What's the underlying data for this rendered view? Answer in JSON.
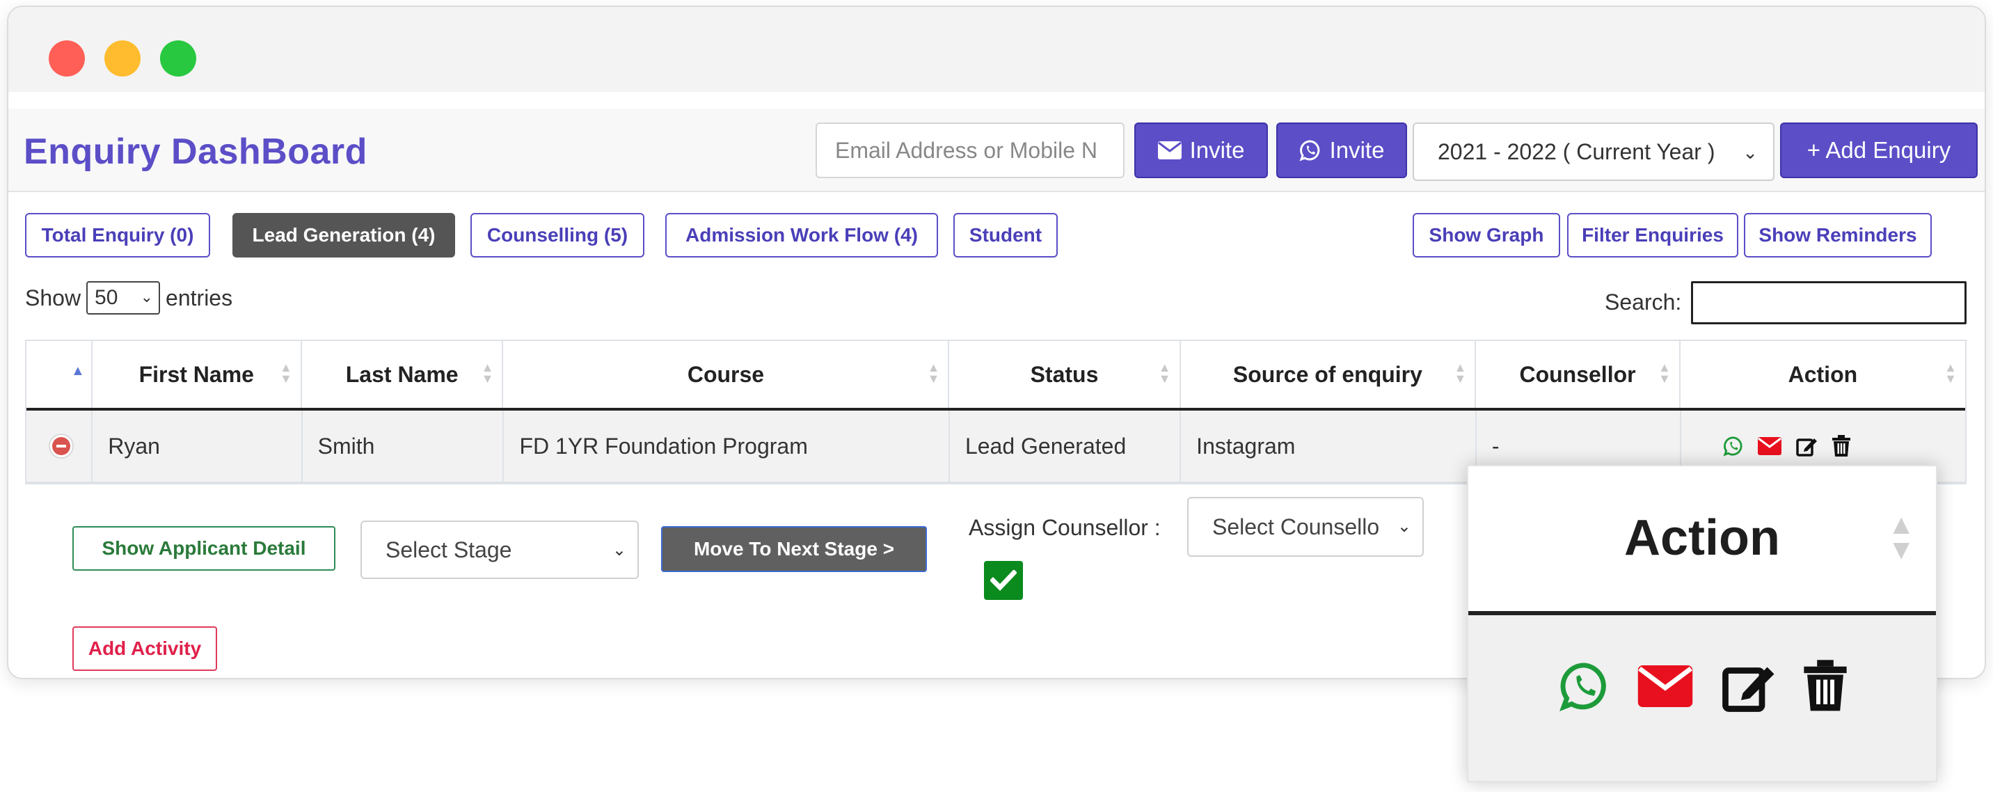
{
  "header": {
    "title": "Enquiry DashBoard",
    "invite_placeholder": "Email Address or Mobile N",
    "email_invite_label": "Invite",
    "whatsapp_invite_label": "Invite",
    "year_selected": "2021 - 2022 ( Current Year )",
    "add_enquiry_label": "+ Add Enquiry"
  },
  "tabs": {
    "total": "Total Enquiry (0)",
    "lead": "Lead Generation (4)",
    "counselling": "Counselling (5)",
    "admission": "Admission Work Flow (4)",
    "student": "Student",
    "show_graph": "Show Graph",
    "filter": "Filter Enquiries",
    "reminders": "Show Reminders"
  },
  "table_controls": {
    "show": "Show",
    "entries_value": "50",
    "entries": "entries",
    "search_label": "Search:"
  },
  "table": {
    "columns": [
      "First Name",
      "Last Name",
      "Course",
      "Status",
      "Source of enquiry",
      "Counsellor",
      "Action"
    ],
    "row": {
      "first_name": "Ryan",
      "last_name": "Smith",
      "course": "FD 1YR Foundation Program",
      "status": "Lead Generated",
      "source": "Instagram",
      "counsellor": "-"
    }
  },
  "child": {
    "show_detail": "Show Applicant Detail",
    "stage_selected": "Select Stage",
    "next_stage": "Move To Next Stage >",
    "assign_label": "Assign Counsellor :",
    "counsellor_selected": "Select Counsello",
    "add_activity": "Add Activity"
  },
  "zoom": {
    "title": "Action"
  },
  "icons": [
    "whatsapp-icon",
    "email-icon",
    "edit-icon",
    "trash-icon",
    "minus-circle-icon",
    "check-icon",
    "sort-icon",
    "chevron-down-icon"
  ],
  "colors": {
    "brand": "#5b4ec7",
    "active_tab": "#555555",
    "whatsapp": "#1d9b3a",
    "email": "#e8101e",
    "danger": "#d9534f",
    "checkbox": "#0b8a1e",
    "add_activity": "#e0204a"
  }
}
